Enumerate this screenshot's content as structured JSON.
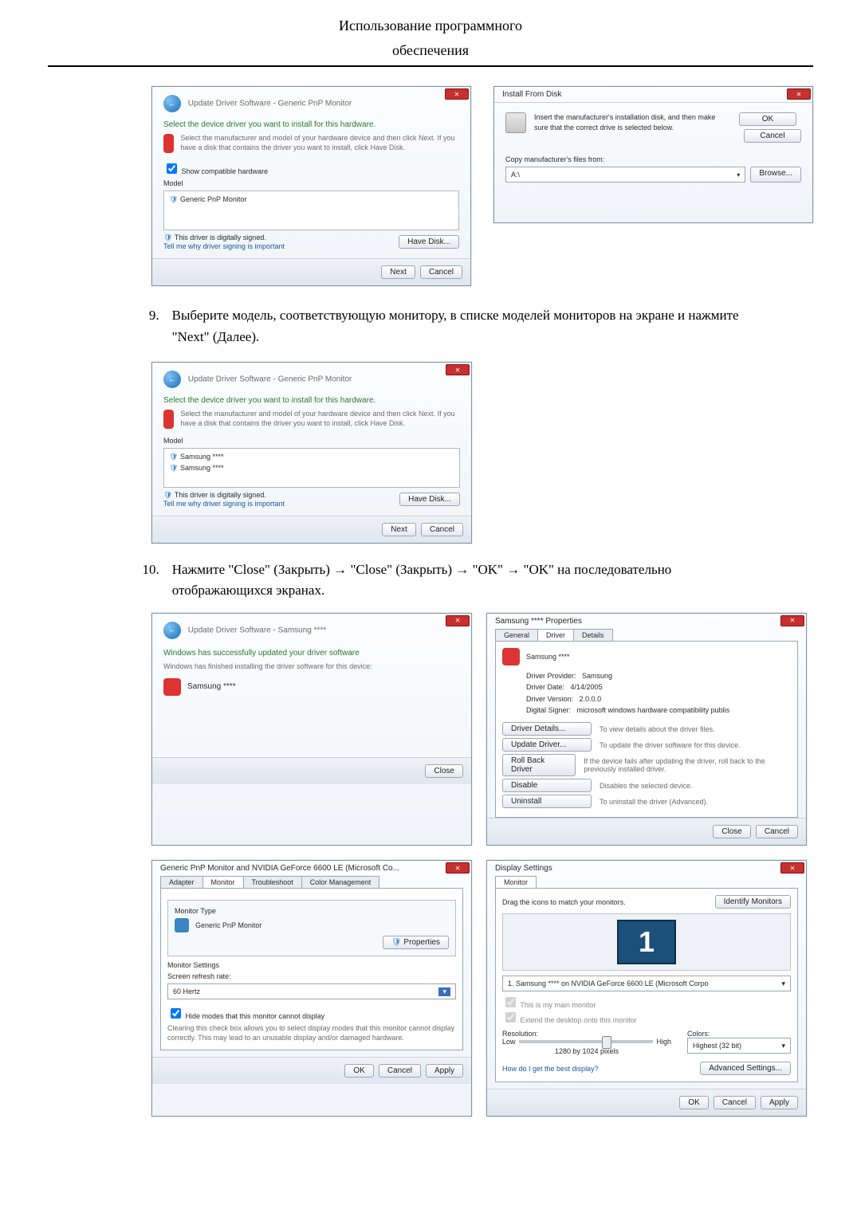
{
  "header": {
    "line1": "Использование программного",
    "line2": "обеспечения"
  },
  "win1": {
    "title": "Update Driver Software - Generic PnP Monitor",
    "heading": "Select the device driver you want to install for this hardware.",
    "hint": "Select the manufacturer and model of your hardware device and then click Next. If you have a disk that contains the driver you want to install, click Have Disk.",
    "show": "Show compatible hardware",
    "model_h": "Model",
    "item": "Generic PnP Monitor",
    "signed": "This driver is digitally signed.",
    "tell": "Tell me why driver signing is important",
    "have": "Have Disk...",
    "next": "Next",
    "cancel": "Cancel"
  },
  "win2": {
    "title": "Install From Disk",
    "msg": "Insert the manufacturer's installation disk, and then make sure that the correct drive is selected below.",
    "ok": "OK",
    "cancel": "Cancel",
    "copy": "Copy manufacturer's files from:",
    "path": "A:\\",
    "browse": "Browse..."
  },
  "step9": {
    "n": "9.",
    "txt": "Выберите модель, соответствующую монитору, в списке моделей мониторов на экране и нажмите \"Next\" (Далее)."
  },
  "win3": {
    "title": "Update Driver Software - Generic PnP Monitor",
    "heading": "Select the device driver you want to install for this hardware.",
    "hint": "Select the manufacturer and model of your hardware device and then click Next. If you have a disk that contains the driver you want to install, click Have Disk.",
    "model_h": "Model",
    "m1": "Samsung ****",
    "m2": "Samsung ****",
    "signed": "This driver is digitally signed.",
    "tell": "Tell me why driver signing is important",
    "have": "Have Disk...",
    "next": "Next",
    "cancel": "Cancel"
  },
  "step10": {
    "n": "10.",
    "txt": "Нажмите \"Close\" (Закрыть) → \"Close\" (Закрыть) → \"OK\" → \"OK\" на последовательно отображающихся экранах."
  },
  "winA": {
    "title": "Update Driver Software - Samsung ****",
    "heading": "Windows has successfully updated your driver software",
    "hint": "Windows has finished installing the driver software for this device:",
    "dev": "Samsung ****",
    "close": "Close"
  },
  "winB": {
    "title": "Samsung **** Properties",
    "tabs": {
      "g": "General",
      "d": "Driver",
      "t": "Details"
    },
    "dev": "Samsung ****",
    "rows": {
      "prov_l": "Driver Provider:",
      "prov_v": "Samsung",
      "date_l": "Driver Date:",
      "date_v": "4/14/2005",
      "ver_l": "Driver Version:",
      "ver_v": "2.0.0.0",
      "sign_l": "Digital Signer:",
      "sign_v": "microsoft windows hardware compatibility publis"
    },
    "btns": {
      "det": "Driver Details...",
      "det_d": "To view details about the driver files.",
      "upd": "Update Driver...",
      "upd_d": "To update the driver software for this device.",
      "rb": "Roll Back Driver",
      "rb_d": "If the device fails after updating the driver, roll back to the previously installed driver.",
      "dis": "Disable",
      "dis_d": "Disables the selected device.",
      "un": "Uninstall",
      "un_d": "To uninstall the driver (Advanced)."
    },
    "close": "Close",
    "cancel": "Cancel"
  },
  "winC": {
    "title": "Generic PnP Monitor and NVIDIA GeForce 6600 LE (Microsoft Co...",
    "tabs": {
      "a": "Adapter",
      "m": "Monitor",
      "t": "Troubleshoot",
      "c": "Color Management"
    },
    "mtype": "Monitor Type",
    "mname": "Generic PnP Monitor",
    "prop": "Properties",
    "mset": "Monitor Settings",
    "rrate": "Screen refresh rate:",
    "hz": "60 Hertz",
    "hide": "Hide modes that this monitor cannot display",
    "hide_d": "Clearing this check box allows you to select display modes that this monitor cannot display correctly. This may lead to an unusable display and/or damaged hardware.",
    "ok": "OK",
    "cancel": "Cancel",
    "apply": "Apply"
  },
  "winD": {
    "title": "Display Settings",
    "tab": "Monitor",
    "drag": "Drag the icons to match your monitors.",
    "ident": "Identify Monitors",
    "monline": "1. Samsung **** on NVIDIA GeForce 6600 LE (Microsoft Corpo",
    "main": "This is my main monitor",
    "ext": "Extend the desktop onto this monitor",
    "res": "Resolution:",
    "col": "Colors:",
    "low": "Low",
    "high": "High",
    "colv": "Highest (32 bit)",
    "resv": "1280 by 1024 pixels",
    "best": "How do I get the best display?",
    "adv": "Advanced Settings...",
    "ok": "OK",
    "cancel": "Cancel",
    "apply": "Apply"
  }
}
